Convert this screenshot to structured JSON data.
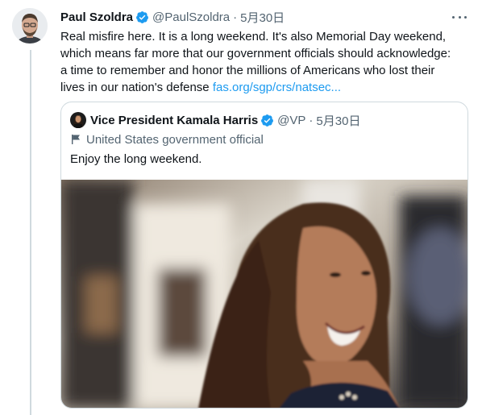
{
  "tweet": {
    "author_name": "Paul Szoldra",
    "handle": "@PaulSzoldra",
    "separator": "·",
    "date": "5月30日",
    "text": "Real misfire here. It is a long weekend. It's also Memorial Day weekend, which means far more that our government officials should acknowledge: a time to remember and honor the millions of Americans who lost their lives in our nation's defense ",
    "link_text": "fas.org/sgp/crs/natsec..."
  },
  "quoted_tweet": {
    "author_name": "Vice President Kamala Harris",
    "handle": "@VP",
    "separator": "·",
    "date": "5月30日",
    "label": "United States government official",
    "text": "Enjoy the long weekend."
  },
  "icons": {
    "verified": "verified-badge-icon",
    "more": "more-options-icon",
    "flag": "government-flag-icon"
  },
  "colors": {
    "accent": "#1d9bf0",
    "secondary_text": "#536471",
    "border": "#cfd9de"
  }
}
